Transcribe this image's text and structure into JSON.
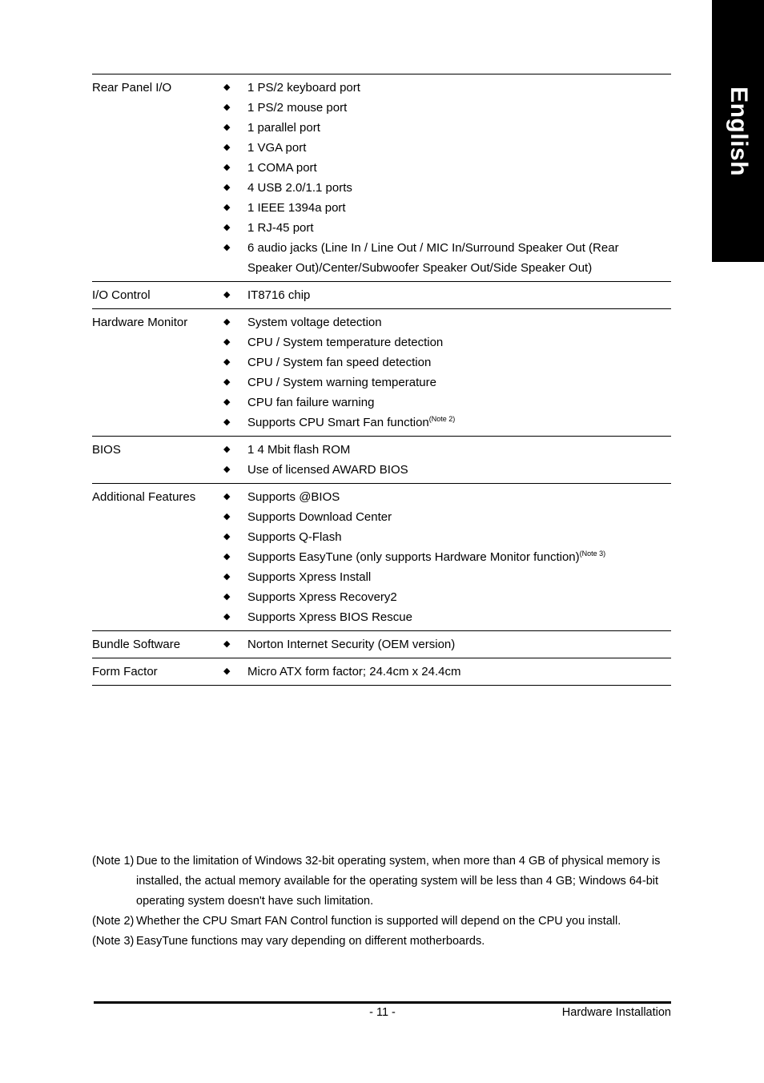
{
  "page": {
    "language_tab": "English",
    "page_number": "- 11 -",
    "section_title": "Hardware Installation"
  },
  "spec_table": {
    "bullet_glyph": "◆",
    "rows": [
      {
        "label": "Rear Panel I/O",
        "items": [
          {
            "text": "1 PS/2 keyboard port"
          },
          {
            "text": "1 PS/2 mouse port"
          },
          {
            "text": "1 parallel port"
          },
          {
            "text": "1 VGA port"
          },
          {
            "text": "1 COMA port"
          },
          {
            "text": "4 USB 2.0/1.1 ports"
          },
          {
            "text": "1 IEEE 1394a port"
          },
          {
            "text": "1 RJ-45 port"
          },
          {
            "text": "6 audio jacks (Line In / Line Out / MIC In/Surround Speaker Out (Rear",
            "cont": "Speaker Out)/Center/Subwoofer Speaker Out/Side Speaker Out)"
          }
        ]
      },
      {
        "label": "I/O Control",
        "items": [
          {
            "text": "IT8716 chip"
          }
        ]
      },
      {
        "label": "Hardware Monitor",
        "items": [
          {
            "text": "System voltage detection"
          },
          {
            "text": "CPU / System temperature detection"
          },
          {
            "text": "CPU / System fan speed detection"
          },
          {
            "text": "CPU / System warning temperature"
          },
          {
            "text": "CPU fan failure warning"
          },
          {
            "text": "Supports CPU Smart Fan function",
            "note": "(Note 2)"
          }
        ]
      },
      {
        "label": "BIOS",
        "items": [
          {
            "text": "1 4 Mbit flash ROM"
          },
          {
            "text": "Use of licensed AWARD BIOS"
          }
        ]
      },
      {
        "label": "Additional Features",
        "items": [
          {
            "text": "Supports @BIOS"
          },
          {
            "text": "Supports Download Center"
          },
          {
            "text": "Supports Q-Flash"
          },
          {
            "text": "Supports EasyTune (only supports Hardware Monitor function)",
            "note": "(Note 3)"
          },
          {
            "text": "Supports Xpress Install"
          },
          {
            "text": "Supports Xpress Recovery2"
          },
          {
            "text": "Supports Xpress BIOS Rescue"
          }
        ]
      },
      {
        "label": "Bundle Software",
        "items": [
          {
            "text": "Norton Internet Security (OEM version)"
          }
        ]
      },
      {
        "label": "Form Factor",
        "items": [
          {
            "text": "Micro ATX form factor; 24.4cm x 24.4cm"
          }
        ]
      }
    ]
  },
  "notes": [
    {
      "tag": "(Note 1)",
      "body": "Due to the limitation of Windows 32-bit operating system, when more than 4 GB of physical memory is installed, the actual memory available for the operating system will be less than 4 GB; Windows 64-bit operating system doesn't have such limitation."
    },
    {
      "tag": "(Note 2)",
      "body": "Whether the CPU Smart FAN Control function is supported will depend on the CPU you install."
    },
    {
      "tag": "(Note 3)",
      "body": "EasyTune functions may vary depending on different motherboards."
    }
  ]
}
